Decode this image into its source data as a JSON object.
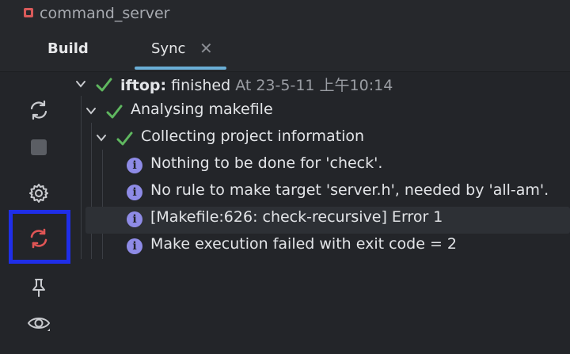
{
  "file_bar": {
    "name": "command_server",
    "icon": "file-icon"
  },
  "tabs": [
    {
      "label": "Build",
      "active": false
    },
    {
      "label": "Sync",
      "active": true,
      "closable": true,
      "close_glyph": "✕"
    }
  ],
  "toolstrip": {
    "items": [
      {
        "icon": "sync-icon"
      },
      {
        "icon": "stop-icon"
      },
      {
        "icon": "gear-icon"
      },
      {
        "icon": "sync-error-icon",
        "highlighted": true
      },
      {
        "icon": "pin-icon"
      },
      {
        "icon": "eye-icon"
      }
    ]
  },
  "tree": {
    "root": {
      "name": "iftop:",
      "status": " finished",
      "timestamp": " At 23-5-11 上午10:14"
    },
    "step1": {
      "label": "Analysing makefile"
    },
    "step2": {
      "label": "Collecting project information"
    },
    "messages": [
      {
        "text": "Nothing to be done for 'check'."
      },
      {
        "text": "No rule to make target 'server.h', needed by 'all-am'."
      },
      {
        "text": "[Makefile:626: check-recursive] Error 1",
        "selected": true
      },
      {
        "text": "Make execution failed with exit code = 2"
      }
    ]
  },
  "colors": {
    "background": "#232529",
    "check": "#5fb75f",
    "info": "#8e8be6",
    "error_icon": "#e05555",
    "highlight_box": "#1f2ee8",
    "tab_underline": "#6aaed6"
  }
}
